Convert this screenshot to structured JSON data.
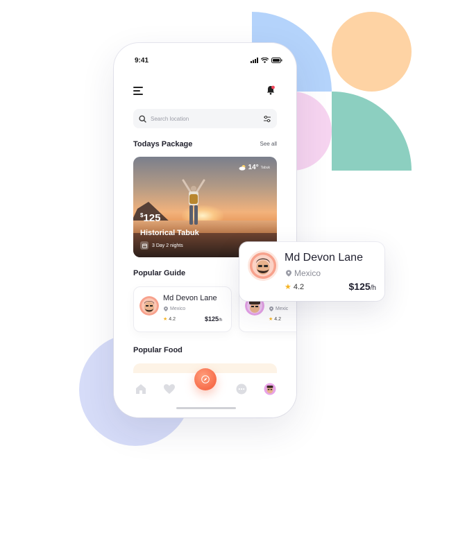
{
  "status_bar": {
    "time": "9:41"
  },
  "search": {
    "placeholder": "Search location"
  },
  "todays_package": {
    "title": "Todays Package",
    "see_all": "See all",
    "card": {
      "temperature": "14°",
      "city": "Tabuk",
      "currency": "$",
      "price": "125",
      "name": "Historical Tabuk",
      "duration": "3 Day 2 nights"
    }
  },
  "popular_guide": {
    "title": "Popular Guide",
    "guides": [
      {
        "name": "Md Devon Lane",
        "location": "Mexico",
        "rating": "4.2",
        "price": "$125",
        "unit": "/h"
      },
      {
        "name": "",
        "location": "Mexic",
        "rating": "4.2"
      }
    ]
  },
  "popular_food": {
    "title": "Popular Food"
  },
  "popup_guide": {
    "name": "Md Devon Lane",
    "location": "Mexico",
    "rating": "4.2",
    "price": "$125",
    "unit": "/h"
  },
  "colors": {
    "accent": "#f76d4b",
    "shape_blue": "#b4d3fb",
    "shape_orange": "#fed3a4",
    "shape_pink": "#f6d4f0",
    "shape_green": "#8ccfc0",
    "shape_lavender": "#d6dcf8",
    "star": "#f5b323"
  },
  "icons": [
    "menu-icon",
    "bell-icon",
    "search-icon",
    "filter-icon",
    "weather-icon",
    "calendar-icon",
    "location-pin-icon",
    "star-icon",
    "home-icon",
    "heart-icon",
    "compass-icon",
    "chat-icon",
    "profile-icon"
  ]
}
